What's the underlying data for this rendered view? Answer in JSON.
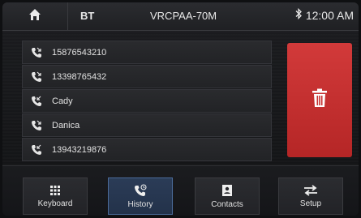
{
  "topbar": {
    "source": "BT",
    "device_name": "VRCPAA-70M",
    "time": "12:00 AM"
  },
  "call_history": [
    {
      "label": "15876543210"
    },
    {
      "label": "13398765432"
    },
    {
      "label": "Cady"
    },
    {
      "label": "Danica"
    },
    {
      "label": "13943219876"
    }
  ],
  "nav": {
    "keyboard": "Keyboard",
    "history": "History",
    "contacts": "Contacts",
    "setup": "Setup",
    "active": "history"
  },
  "colors": {
    "delete": "#c62f2f",
    "active_tab": "#2b3c57"
  }
}
